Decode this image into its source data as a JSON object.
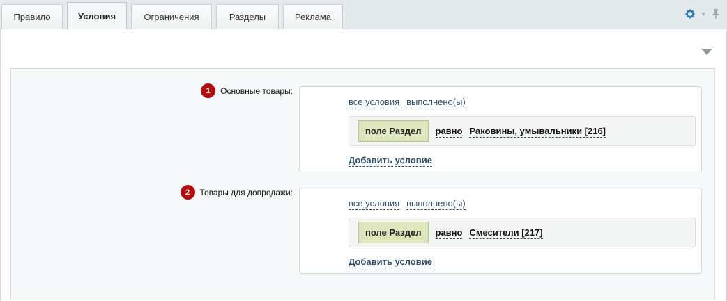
{
  "tabs": [
    {
      "label": "Правило"
    },
    {
      "label": "Условия"
    },
    {
      "label": "Ограничения"
    },
    {
      "label": "Разделы"
    },
    {
      "label": "Реклама"
    }
  ],
  "active_tab": "Условия",
  "icons": {
    "settings": "gear-icon",
    "pin": "pin-icon",
    "collapse": "triangle-down-icon"
  },
  "colors": {
    "badge": "#b50d0d",
    "link": "#2c4e6c",
    "field_button": "#dde6bd"
  },
  "groups": [
    {
      "number": "1",
      "label": "Основные товары:",
      "all_link": "все условия",
      "done_link": "выполнено(ы)",
      "condition": {
        "field": "поле Раздел",
        "operator": "равно",
        "value": "Раковины, умывальники [216]"
      },
      "add_label": "Добавить условие"
    },
    {
      "number": "2",
      "label": "Товары для допродажи:",
      "all_link": "все условия",
      "done_link": "выполнено(ы)",
      "condition": {
        "field": "поле Раздел",
        "operator": "равно",
        "value": "Смесители [217]"
      },
      "add_label": "Добавить условие"
    }
  ]
}
